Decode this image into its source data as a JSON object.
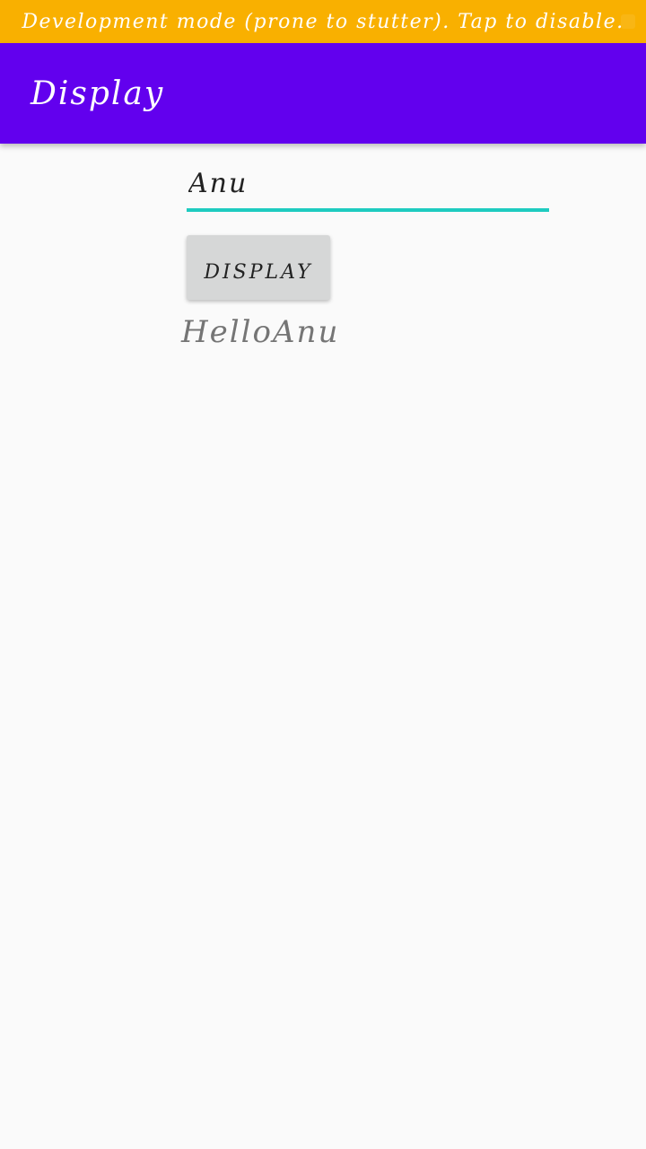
{
  "banner": {
    "text": "Development mode (prone to stutter). Tap to disable.",
    "color": "#f9b000"
  },
  "app_bar": {
    "title": "Display",
    "color": "#6200ee"
  },
  "form": {
    "name_value": "Anu",
    "underline_color": "#1ecbc0",
    "button_label": "DISPLAY",
    "result_text": "HelloAnu"
  }
}
